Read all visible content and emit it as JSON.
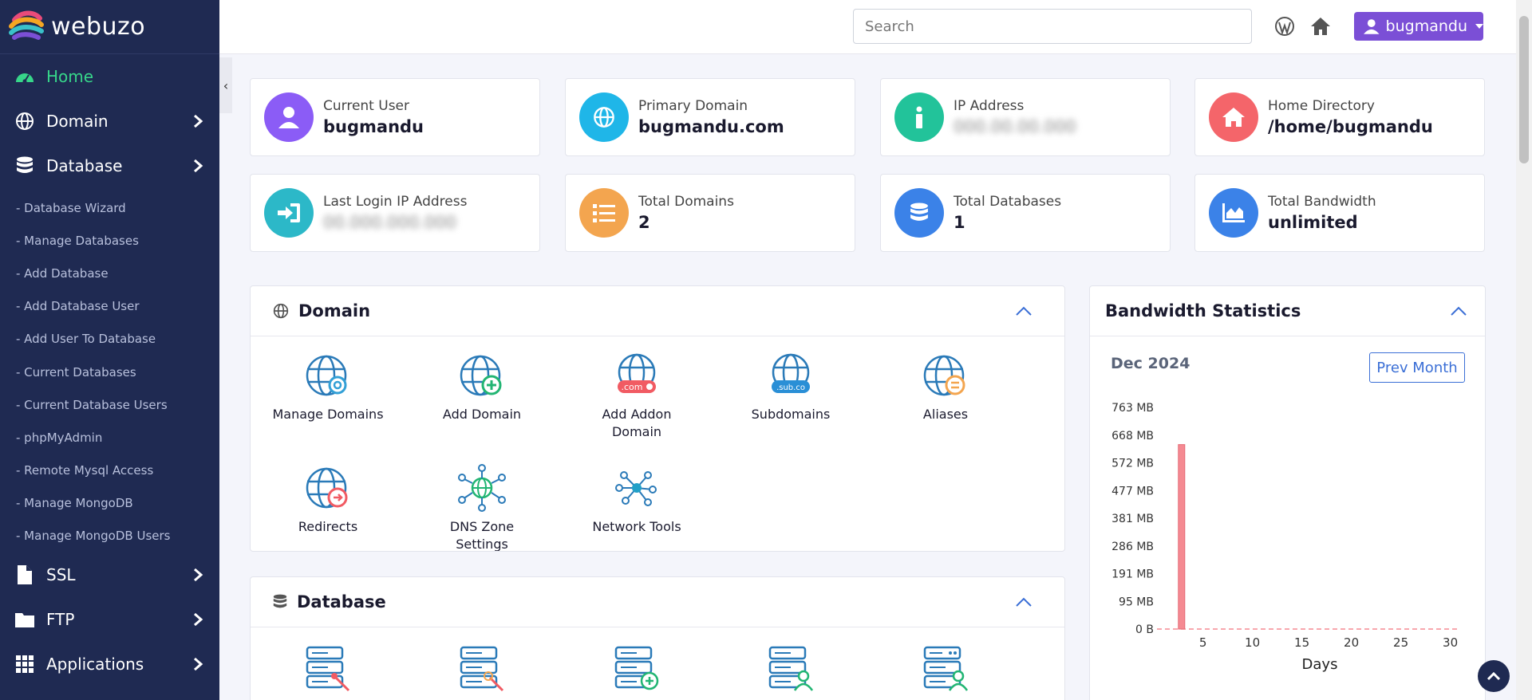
{
  "brand": {
    "name": "webuzo"
  },
  "sidebar": {
    "items": [
      {
        "label": "Home",
        "icon": "dashboard-icon",
        "active": true
      },
      {
        "label": "Domain",
        "icon": "globe-icon"
      },
      {
        "label": "Database",
        "icon": "database-icon"
      }
    ],
    "database_sub": [
      "- Database Wizard",
      "- Manage Databases",
      "- Add Database",
      "- Add Database User",
      "- Add User To Database",
      "- Current Databases",
      "- Current Database Users",
      "- phpMyAdmin",
      "- Remote Mysql Access",
      "- Manage MongoDB",
      "- Manage MongoDB Users"
    ],
    "items_after": [
      {
        "label": "SSL",
        "icon": "file-icon"
      },
      {
        "label": "FTP",
        "icon": "folder-icon"
      },
      {
        "label": "Applications",
        "icon": "grid-icon"
      }
    ],
    "collapse_glyph": "‹"
  },
  "topbar": {
    "search_placeholder": "Search",
    "user": "bugmandu"
  },
  "stats": [
    {
      "label": "Current User",
      "value": "bugmandu",
      "color": "#8b5cf6",
      "icon": "user-icon"
    },
    {
      "label": "Primary Domain",
      "value": "bugmandu.com",
      "color": "#1fb6e8",
      "icon": "globe-icon"
    },
    {
      "label": "IP Address",
      "value": "000.00.00.000",
      "color": "#22c39a",
      "icon": "info-icon",
      "blurred": true
    },
    {
      "label": "Home Directory",
      "value": "/home/bugmandu",
      "color": "#f4656a",
      "icon": "house-icon"
    },
    {
      "label": "Last Login IP Address",
      "value": "00.000.000.000",
      "color": "#2cb8c8",
      "icon": "sign-in-icon",
      "blurred": true
    },
    {
      "label": "Total Domains",
      "value": "2",
      "color": "#f3a54f",
      "icon": "list-icon"
    },
    {
      "label": "Total Databases",
      "value": "1",
      "color": "#3b82e8",
      "icon": "database-icon"
    },
    {
      "label": "Total Bandwidth",
      "value": "unlimited",
      "color": "#3b82e8",
      "icon": "chart-area-icon"
    }
  ],
  "domain_panel": {
    "title": "Domain",
    "tools": [
      "Manage Domains",
      "Add Domain",
      "Add Addon Domain",
      "Subdomains",
      "Aliases",
      "Redirects",
      "DNS Zone Settings",
      "Network Tools"
    ]
  },
  "database_panel": {
    "title": "Database"
  },
  "bandwidth": {
    "title": "Bandwidth Statistics",
    "month": "Dec 2024",
    "prev_label": "Prev Month"
  },
  "chart_data": {
    "type": "bar",
    "xlabel": "Days",
    "ylabel": "",
    "y_ticks": [
      "763 MB",
      "668 MB",
      "572 MB",
      "477 MB",
      "381 MB",
      "286 MB",
      "191 MB",
      "95 MB",
      "0 B"
    ],
    "x_ticks": [
      5,
      10,
      15,
      20,
      25,
      30
    ],
    "xlim": [
      1,
      31
    ],
    "ylim_mb": [
      0,
      763
    ],
    "bars": [
      {
        "day": 3,
        "value_mb": 635
      }
    ],
    "bar_color": "#f58a92",
    "grid": false
  }
}
